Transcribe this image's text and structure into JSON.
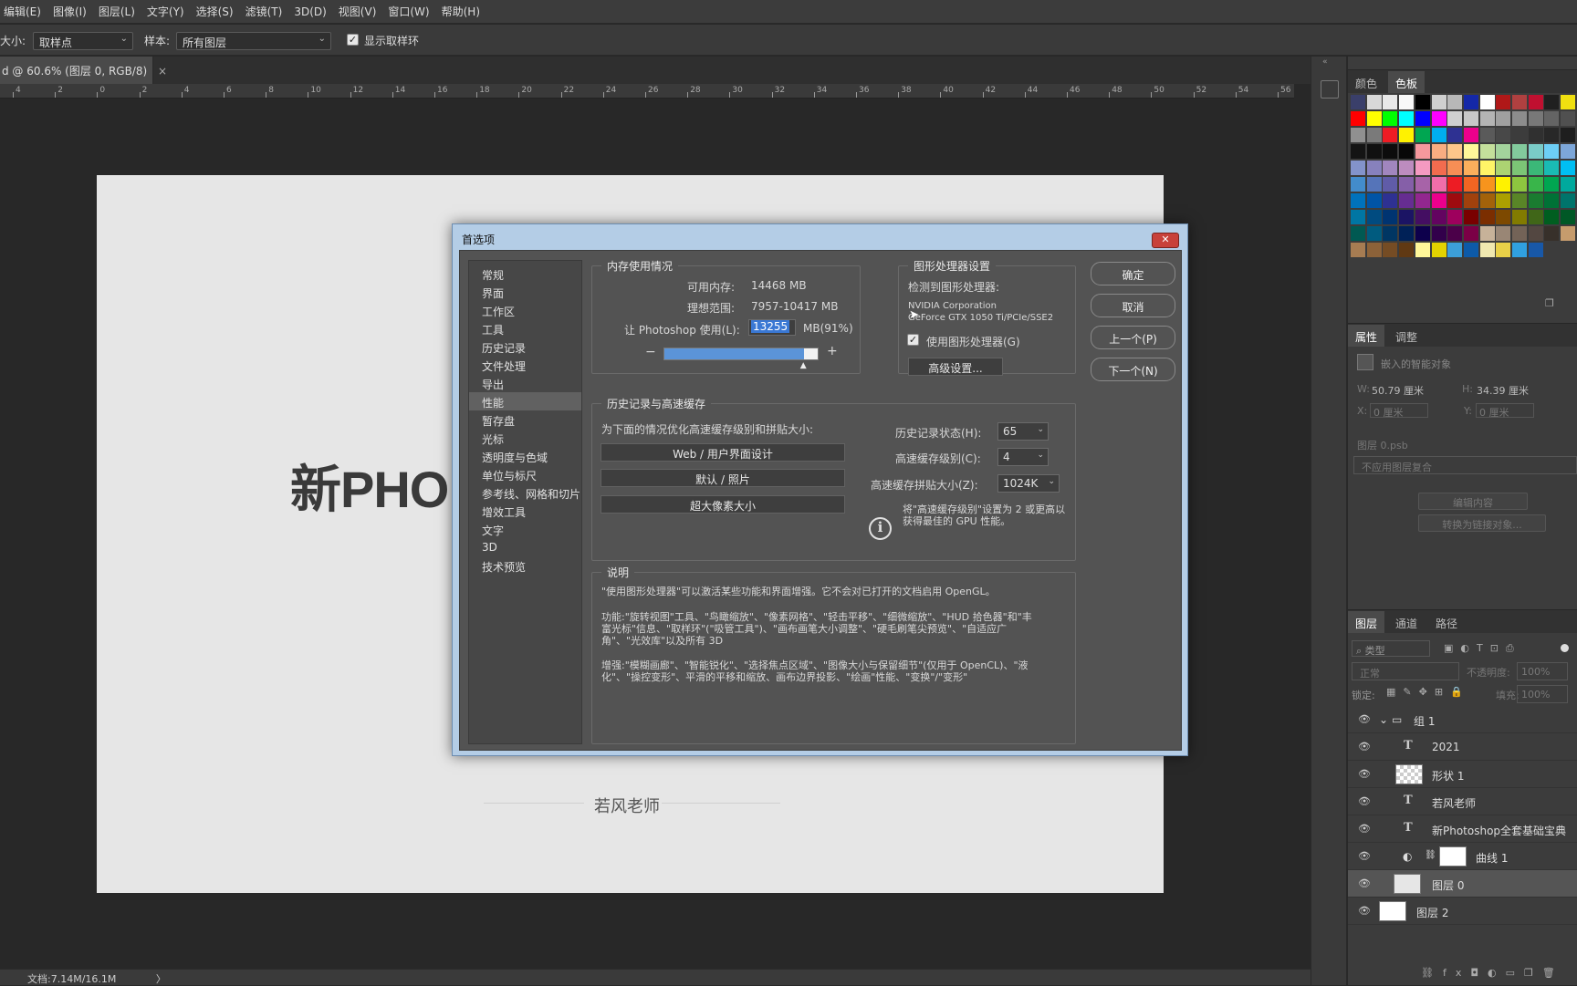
{
  "menubar": [
    "编辑(E)",
    "图像(I)",
    "图层(L)",
    "文字(Y)",
    "选择(S)",
    "滤镜(T)",
    "3D(D)",
    "视图(V)",
    "窗口(W)",
    "帮助(H)"
  ],
  "options": {
    "size_label": "大小:",
    "size_value": "取样点",
    "sample_label": "样本:",
    "sample_value": "所有图层",
    "show_ring_label": "显示取样环"
  },
  "document": {
    "tab_title": "d @ 60.6% (图层 0, RGB/8)",
    "tab_close": "×",
    "ruler_ticks": [
      "4",
      "2",
      "0",
      "2",
      "4",
      "6",
      "8",
      "10",
      "12",
      "14",
      "16",
      "18",
      "20",
      "22",
      "24",
      "26",
      "28",
      "30",
      "32",
      "34",
      "36",
      "38",
      "40",
      "42",
      "44",
      "46",
      "48",
      "50",
      "52",
      "54",
      "56"
    ],
    "big_text": "新PHO",
    "author_text": "若风老师",
    "status": "文档:7.14M/16.1M",
    "status_arrow": "〉"
  },
  "dialog": {
    "title": "首选项",
    "close": "✕",
    "categories": [
      "常规",
      "界面",
      "工作区",
      "工具",
      "历史记录",
      "文件处理",
      "导出",
      "性能",
      "暂存盘",
      "光标",
      "透明度与色域",
      "单位与标尺",
      "参考线、网格和切片",
      "增效工具",
      "文字",
      "3D",
      "技术预览"
    ],
    "active_category": "性能",
    "memory": {
      "title": "内存使用情况",
      "available_label": "可用内存:",
      "available_value": "14468 MB",
      "ideal_label": "理想范围:",
      "ideal_value": "7957-10417 MB",
      "let_label": "让 Photoshop 使用(L):",
      "let_value": "13255",
      "let_unit": "MB(91%)",
      "slider_fraction": 0.91,
      "minus": "−",
      "plus": "+"
    },
    "gpu": {
      "title": "图形处理器设置",
      "detected_label": "检测到图形处理器:",
      "vendor": "NVIDIA Corporation",
      "model": "GeForce GTX 1050 Ti/PCIe/SSE2",
      "use_label": "使用图形处理器(G)",
      "advanced_button": "高级设置..."
    },
    "history": {
      "title": "历史记录与高速缓存",
      "optimize_label": "为下面的情况优化高速缓存级别和拼贴大小:",
      "buttons": [
        "Web / 用户界面设计",
        "默认 / 照片",
        "超大像素大小"
      ],
      "states_label": "历史记录状态(H):",
      "states_value": "65",
      "levels_label": "高速缓存级别(C):",
      "levels_value": "4",
      "tile_label": "高速缓存拼贴大小(Z):",
      "tile_value": "1024K",
      "info_icon": "i",
      "tip": "将\"高速缓存级别\"设置为 2 或更高以获得最佳的 GPU 性能。"
    },
    "description": {
      "title": "说明",
      "p1": "\"使用图形处理器\"可以激活某些功能和界面增强。它不会对已打开的文档启用 OpenGL。",
      "p2": "功能:\"旋转视图\"工具、\"鸟瞰缩放\"、\"像素网格\"、\"轻击平移\"、\"细微缩放\"、\"HUD 拾色器\"和\"丰富光标\"信息、\"取样环\"(\"吸管工具\")、\"画布画笔大小调整\"、\"硬毛刷笔尖预览\"、\"自适应广角\"、\"光效库\"以及所有 3D",
      "p3": "增强:\"模糊画廊\"、\"智能锐化\"、\"选择焦点区域\"、\"图像大小与保留细节\"(仅用于 OpenCL)、\"液化\"、\"操控变形\"、平滑的平移和缩放、画布边界投影、\"绘画\"性能、\"变换\"/\"变形\""
    },
    "buttons": {
      "ok": "确定",
      "cancel": "取消",
      "prev": "上一个(P)",
      "next": "下一个(N)"
    }
  },
  "panels": {
    "color_tabs": [
      "颜色",
      "色板"
    ],
    "swatch_colors": [
      "#3a3f6a",
      "#d8d8d8",
      "#e8e8e8",
      "#f8f8f8",
      "#000000",
      "#cfcfcf",
      "#b8b8b8",
      "#1428a8",
      "#ffffff",
      "#b01818",
      "#b04040",
      "#c01030",
      "#202020",
      "#f0e010",
      "#ff0000",
      "#ffff00",
      "#00ff00",
      "#00ffff",
      "#0000ff",
      "#ff00ff",
      "#d0d0d0",
      "#c8c8c8",
      "#b4b4b4",
      "#a0a0a0",
      "#8c8c8c",
      "#787878",
      "#646464",
      "#505050",
      "#909090",
      "#7a7a7a",
      "#ee1c24",
      "#fff200",
      "#00a651",
      "#00aeef",
      "#2e3192",
      "#ec008c",
      "#5a5a5a",
      "#484848",
      "#3c3c3c",
      "#303030",
      "#282828",
      "#1e1e1e",
      "#141414",
      "#101010",
      "#0c0c0c",
      "#080808",
      "#f5989d",
      "#f9ad81",
      "#fdc68a",
      "#fff799",
      "#c4df9b",
      "#a3d39c",
      "#82ca9c",
      "#7accc8",
      "#6dcff6",
      "#7da7d9",
      "#8393ca",
      "#8781bd",
      "#a186be",
      "#bd8cbf",
      "#f49ac1",
      "#f26c4f",
      "#f68e55",
      "#fbaf5c",
      "#fff467",
      "#acd372",
      "#7cc576",
      "#3bb878",
      "#1abbb4",
      "#00bff3",
      "#438ccb",
      "#5574b9",
      "#605ca8",
      "#855fa8",
      "#a763a8",
      "#f06eaa",
      "#ed1c24",
      "#f26522",
      "#f7941d",
      "#fff200",
      "#8dc63f",
      "#39b54a",
      "#00a651",
      "#00a99d",
      "#0072bc",
      "#0054a6",
      "#2e3192",
      "#662d91",
      "#92278f",
      "#ec008c",
      "#9e0b0f",
      "#a0410d",
      "#a3620a",
      "#aba000",
      "#598527",
      "#1a7b30",
      "#007236",
      "#00746b",
      "#0076a3",
      "#004b80",
      "#003471",
      "#1b1464",
      "#440e62",
      "#630460",
      "#9e005d",
      "#790000",
      "#7b2e00",
      "#7d4900",
      "#827b00",
      "#406618",
      "#005e20",
      "#005826",
      "#005952",
      "#005b7f",
      "#003663",
      "#002157",
      "#0d004c",
      "#32004b",
      "#4b0049",
      "#7b0046",
      "#c7b299",
      "#998675",
      "#736357",
      "#534741",
      "#37302a",
      "#c69c6d",
      "#a67c52",
      "#8c6239",
      "#754c24",
      "#603913",
      "#fff799",
      "#e3d200",
      "#3c9fd8",
      "#0d5aa8",
      "#f0e8b0",
      "#e8d048",
      "#30a0e0",
      "#1858a8"
    ],
    "props_tabs": [
      "属性",
      "调整"
    ],
    "props": {
      "smart_obj": "嵌入的智能对象",
      "w_label": "W:",
      "w_value": "50.79 厘米",
      "h_label": "H:",
      "h_value": "34.39 厘米",
      "x_label": "X:",
      "x_value": "0 厘米",
      "y_label": "Y:",
      "y_value": "0 厘米",
      "layer_comp": "图层 0.psb",
      "no_comp": "不应用图层复合",
      "edit_btn": "编辑内容",
      "convert_btn": "转换为链接对象..."
    },
    "layers_tabs": [
      "图层",
      "通道",
      "路径"
    ],
    "layers": {
      "filter_placeholder": "类型",
      "blend": "正常",
      "opacity_label": "不透明度:",
      "opacity_value": "100%",
      "lock_label": "锁定:",
      "fill_label": "填充:",
      "fill_value": "100%",
      "items": [
        {
          "name": "组 1",
          "kind": "group"
        },
        {
          "name": "2021",
          "kind": "text"
        },
        {
          "name": "形状 1",
          "kind": "shape"
        },
        {
          "name": "若风老师",
          "kind": "text"
        },
        {
          "name": "新Photoshop全套基础宝典",
          "kind": "text"
        },
        {
          "name": "曲线 1",
          "kind": "adjust"
        },
        {
          "name": "图层 0",
          "kind": "smart"
        },
        {
          "name": "图层 2",
          "kind": "pixel"
        }
      ],
      "selected_index": 6
    }
  }
}
